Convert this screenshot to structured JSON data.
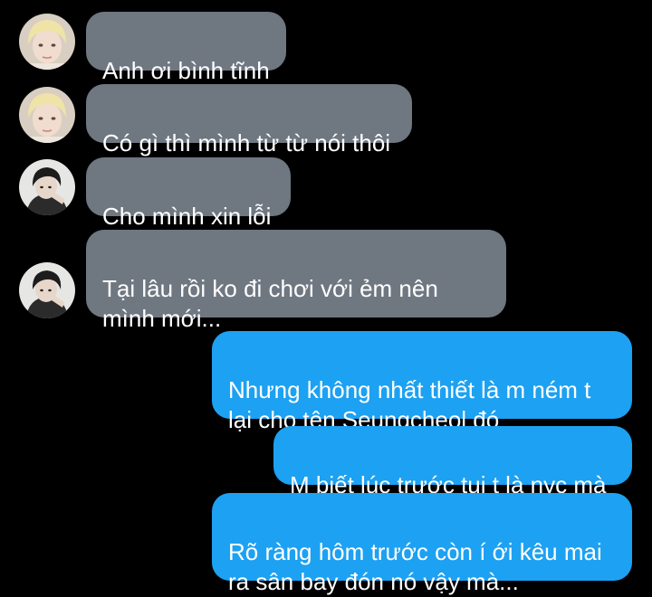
{
  "colors": {
    "background": "#000000",
    "incoming_bubble": "#6f7781",
    "outgoing_bubble": "#1da1f2",
    "text": "#ffffff"
  },
  "messages": [
    {
      "direction": "incoming",
      "avatar": "blonde-person-avatar",
      "text": "Anh ơi bình tĩnh"
    },
    {
      "direction": "incoming",
      "avatar": "blonde-person-avatar",
      "text": "Có gì thì mình từ từ nói thôi"
    },
    {
      "direction": "incoming",
      "avatar": "dark-haired-person-avatar",
      "text": "Cho mình xin lỗi"
    },
    {
      "direction": "incoming",
      "avatar": "dark-haired-person-avatar",
      "text": "Tại lâu rồi ko đi chơi với ẻm nên\nmình mới..."
    },
    {
      "direction": "outgoing",
      "text": "Nhưng không nhất thiết là m ném t\nlại cho tên Seungcheol đó"
    },
    {
      "direction": "outgoing",
      "text": "M biết lúc trước tụi t là nyc mà"
    },
    {
      "direction": "outgoing",
      "text": "Rõ ràng hôm trước còn í ới kêu mai\nra sân bay đón nó vậy mà..."
    }
  ]
}
